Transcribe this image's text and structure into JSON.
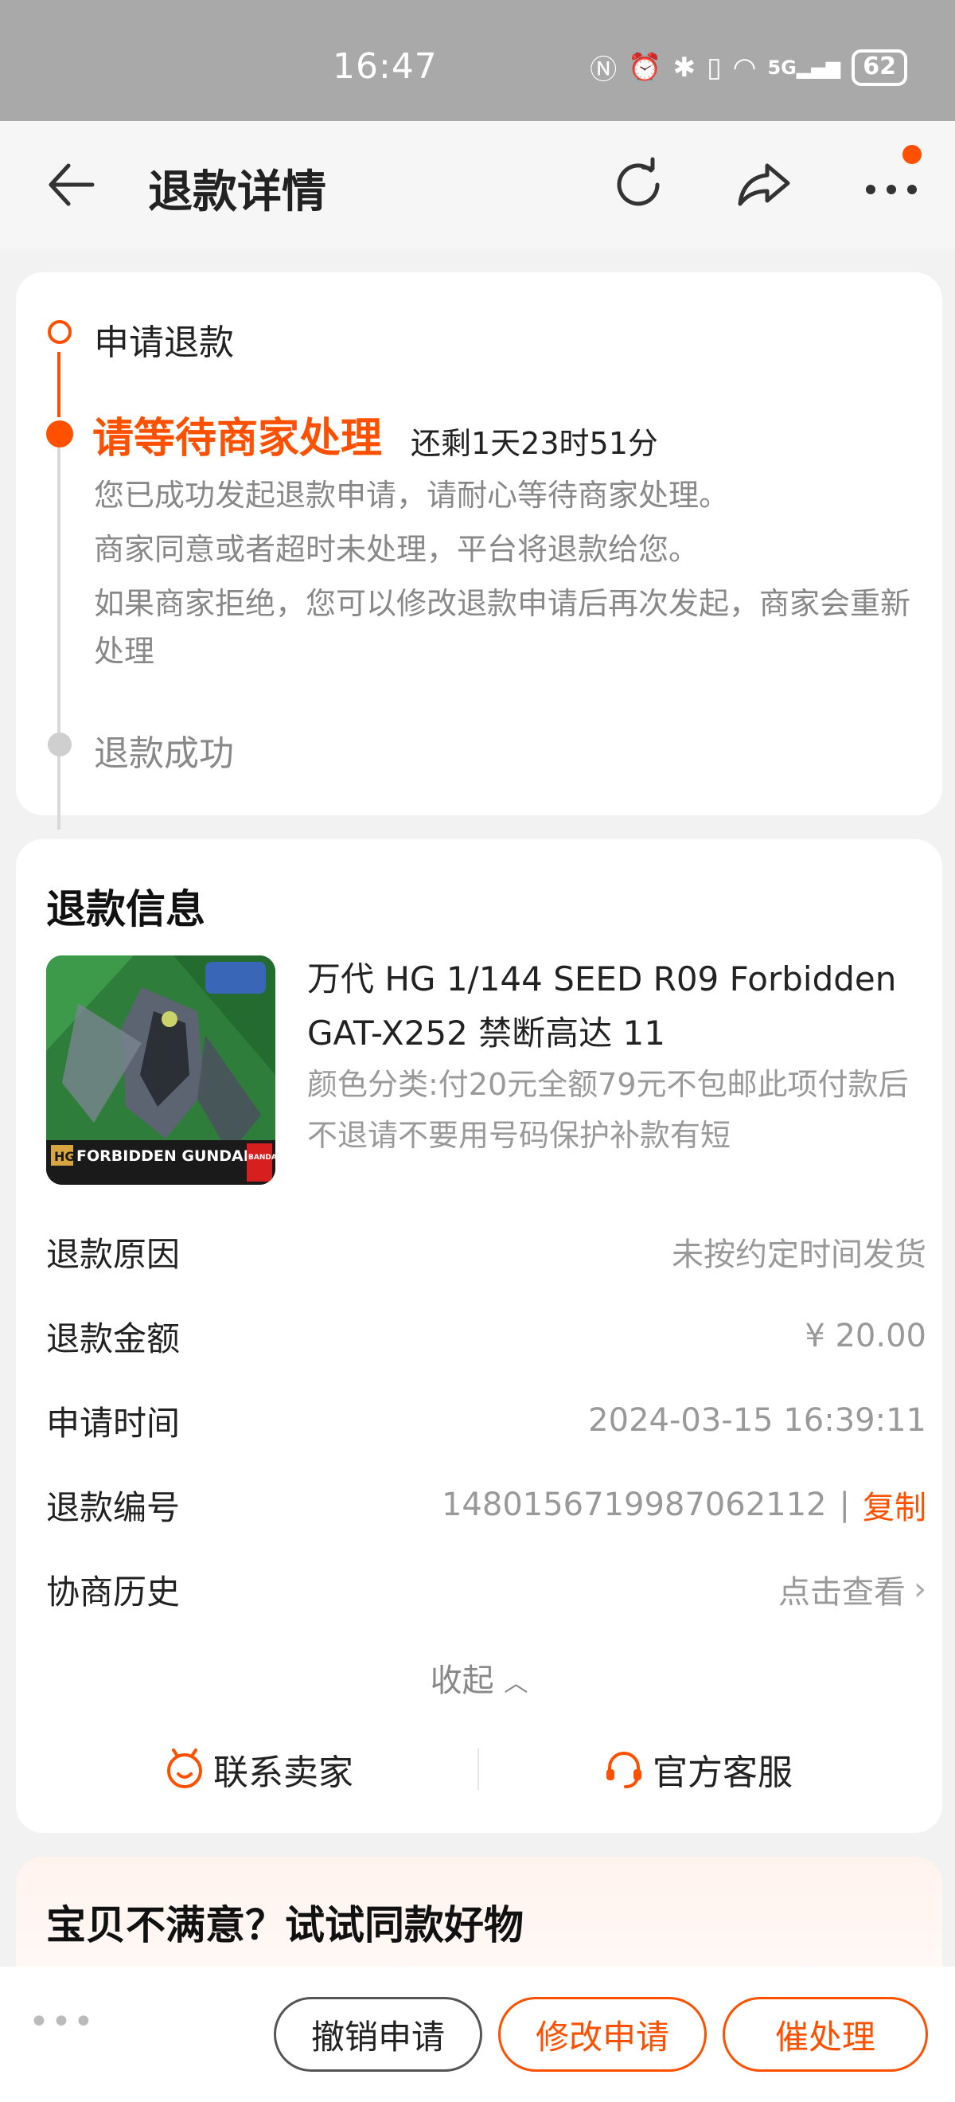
{
  "status_bar": {
    "time": "16:47",
    "icons": [
      "nfc-icon",
      "alarm-icon",
      "bluetooth-icon",
      "vibrate-icon",
      "wifi-icon",
      "signal-5g-icon"
    ],
    "network": "5G",
    "battery": "62"
  },
  "header": {
    "title": "退款详情",
    "has_notification_dot": true
  },
  "progress": {
    "step1": "申请退款",
    "step2": "请等待商家处理",
    "remaining": "还剩1天23时51分",
    "desc1": "您已成功发起退款申请，请耐心等待商家处理。",
    "desc2": "商家同意或者超时未处理，平台将退款给您。",
    "desc3": "如果商家拒绝，您可以修改退款申请后再次发起，商家会重新处理",
    "step3": "退款成功"
  },
  "refund_info": {
    "section_title": "退款信息",
    "product": {
      "title": "万代 HG 1/144 SEED R09 Forbidden GAT-X252 禁断高达 11",
      "sku": "颜色分类:付20元全额79元不包邮此项付款后不退请不要用号码保护补款有短",
      "box_text": "FORBIDDEN GUNDAM",
      "box_badge": "HG",
      "brand": "BANDAI"
    },
    "rows": [
      {
        "label": "退款原因",
        "value": "未按约定时间发货"
      },
      {
        "label": "退款金额",
        "value": "¥ 20.00"
      },
      {
        "label": "申请时间",
        "value": "2024-03-15 16:39:11"
      },
      {
        "label": "退款编号",
        "value": "1480156719987062112",
        "action": "复制"
      },
      {
        "label": "协商历史",
        "value": "点击查看"
      }
    ],
    "collapse_label": "收起",
    "contact_seller": "联系卖家",
    "official_service": "官方客服"
  },
  "recommend": {
    "title": "宝贝不满意？试试同款好物"
  },
  "bottom_bar": {
    "more": "•••",
    "cancel": "撤销申请",
    "modify": "修改申请",
    "urge": "催处理"
  },
  "colors": {
    "accent": "#ff5000",
    "grey_text": "#999999",
    "status_bar": "#a9a9a9"
  }
}
